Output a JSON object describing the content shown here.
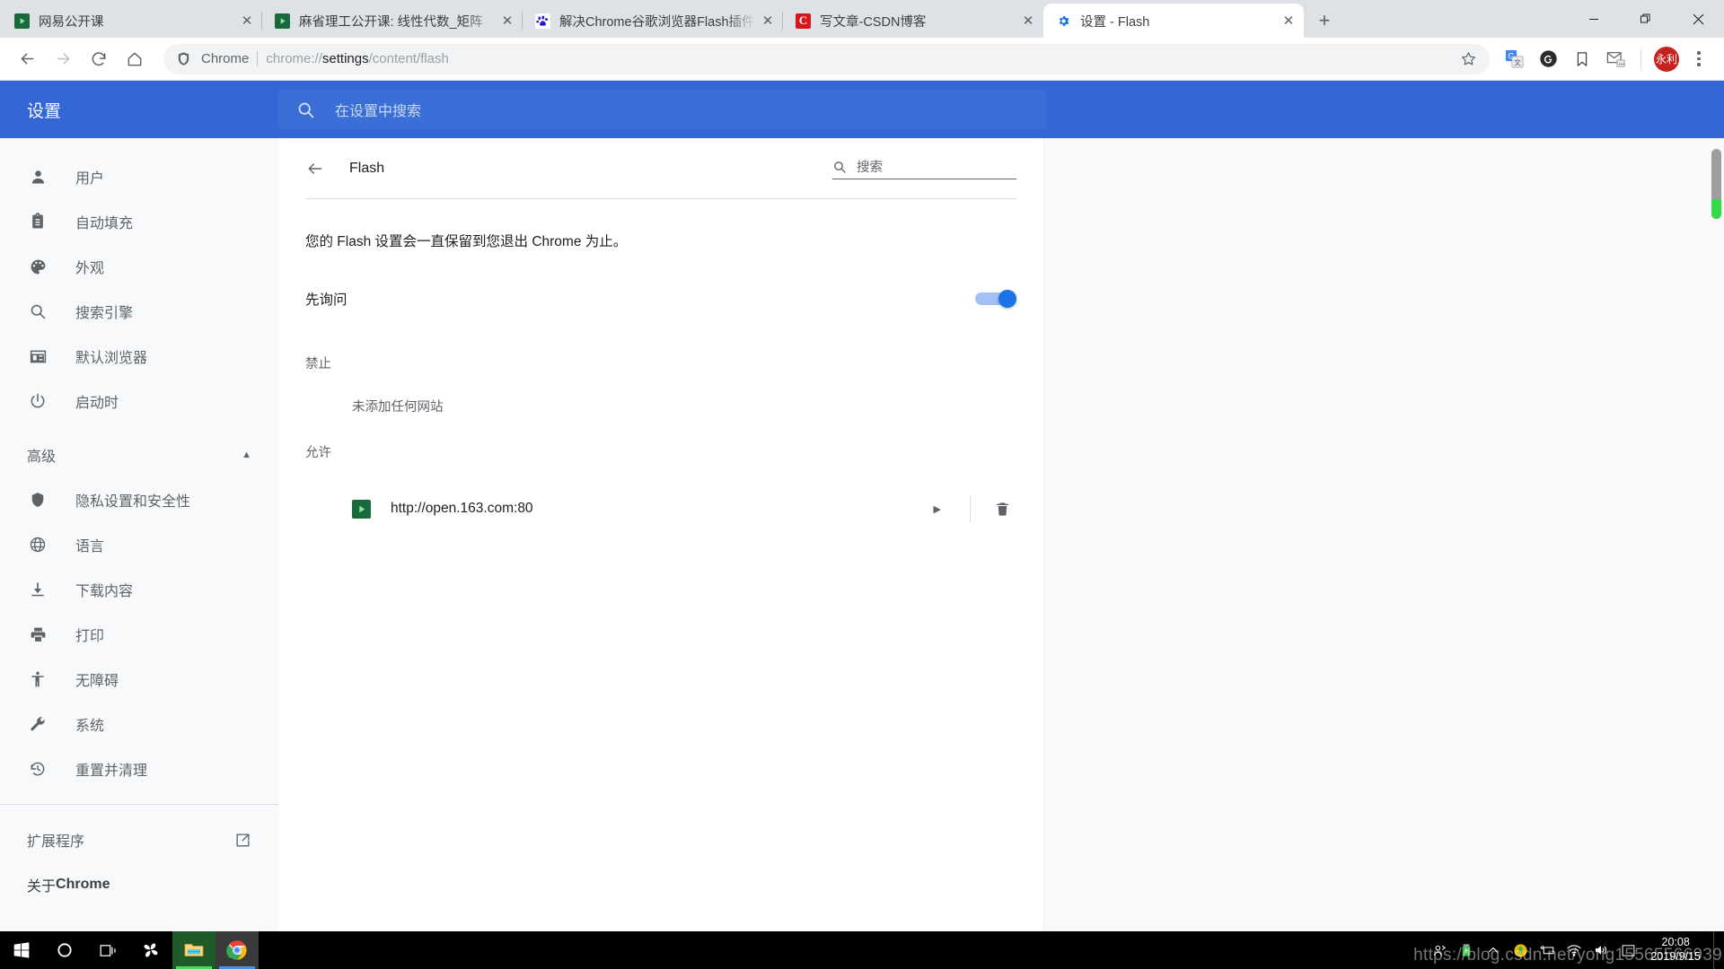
{
  "browser": {
    "tabs": [
      {
        "title": "网易公开课",
        "favicon": "play-green-icon",
        "active": false
      },
      {
        "title": "麻省理工公开课: 线性代数_矩阵",
        "favicon": "play-green-icon",
        "active": false
      },
      {
        "title": "解决Chrome谷歌浏览器Flash插件",
        "favicon": "baidu-icon",
        "active": false
      },
      {
        "title": "写文章-CSDN博客",
        "favicon": "csdn-icon",
        "active": false
      },
      {
        "title": "设置 - Flash",
        "favicon": "gear-blue-icon",
        "active": true
      }
    ],
    "tab_close_label": "✕",
    "new_tab_label": "+",
    "window_controls": {
      "minimize": "—",
      "restore": "❐",
      "close": "✕"
    },
    "toolbar": {
      "back_icon": "arrow-left-icon",
      "forward_icon": "arrow-right-icon",
      "reload_icon": "reload-icon",
      "home_icon": "home-icon",
      "omnibox_scheme": "Chrome",
      "omnibox_url_prefix": "chrome://",
      "omnibox_url_bold": "settings",
      "omnibox_url_suffix": "/content/flash",
      "star_icon": "star-icon",
      "extensions": [
        "google-translate-icon",
        "grammarly-icon",
        "bookmark-icon",
        "mail-icon"
      ],
      "avatar_label": "永利",
      "menu_icon": "three-dots-menu-icon"
    }
  },
  "settings": {
    "header_title": "设置",
    "search_placeholder": "在设置中搜索",
    "search_icon": "search-icon",
    "sidebar": {
      "items": [
        {
          "label": "用户",
          "icon": "person-icon"
        },
        {
          "label": "自动填充",
          "icon": "clipboard-icon"
        },
        {
          "label": "外观",
          "icon": "palette-icon"
        },
        {
          "label": "搜索引擎",
          "icon": "search-icon"
        },
        {
          "label": "默认浏览器",
          "icon": "browser-window-icon"
        },
        {
          "label": "启动时",
          "icon": "power-icon"
        }
      ],
      "advanced_label": "高级",
      "advanced_chevron": "chevron-up-icon",
      "advanced_items": [
        {
          "label": "隐私设置和安全性",
          "icon": "shield-icon"
        },
        {
          "label": "语言",
          "icon": "globe-icon"
        },
        {
          "label": "下载内容",
          "icon": "download-icon"
        },
        {
          "label": "打印",
          "icon": "printer-icon"
        },
        {
          "label": "无障碍",
          "icon": "accessibility-icon"
        },
        {
          "label": "系统",
          "icon": "wrench-icon"
        },
        {
          "label": "重置并清理",
          "icon": "history-restore-icon"
        }
      ],
      "extensions_label": "扩展程序",
      "extensions_icon": "external-link-icon",
      "about_prefix": "关于 ",
      "about_label": "Chrome"
    },
    "content": {
      "back_icon": "arrow-left-icon",
      "page_title": "Flash",
      "sub_search_placeholder": "搜索",
      "sub_search_icon": "search-icon",
      "description": "您的 Flash 设置会一直保留到您退出 Chrome 为止。",
      "toggle_label": "先询问",
      "toggle_state": "on",
      "toggle_accent": "#1a73e8",
      "block_section_label": "禁止",
      "block_empty_text": "未添加任何网站",
      "allow_section_label": "允许",
      "allow_sites": [
        {
          "url": "http://open.163.com:80",
          "favicon": "play-green-icon",
          "expand_icon": "chevron-right-icon",
          "delete_icon": "trash-icon"
        }
      ]
    }
  },
  "taskbar": {
    "start_icon": "windows-start-icon",
    "search_icon": "cortana-circle-icon",
    "taskview_icon": "task-view-icon",
    "pinned": [
      {
        "icon": "pinwheel-icon",
        "running": false
      },
      {
        "icon": "file-explorer-icon",
        "running": true
      },
      {
        "icon": "chrome-icon",
        "running": true
      }
    ],
    "tray": [
      {
        "icon": "people-icon"
      },
      {
        "icon": "usb-drive-icon"
      },
      {
        "icon": "chevron-up-icon"
      },
      {
        "icon": "shield-update-icon"
      },
      {
        "icon": "plug-monitor-icon"
      },
      {
        "icon": "wifi-icon"
      },
      {
        "icon": "volume-icon"
      },
      {
        "icon": "action-center-icon"
      }
    ],
    "clock_time": "20:08",
    "clock_date": "2019/9/15",
    "watermark": "https://blog.csdn.net/yong15565566939"
  }
}
